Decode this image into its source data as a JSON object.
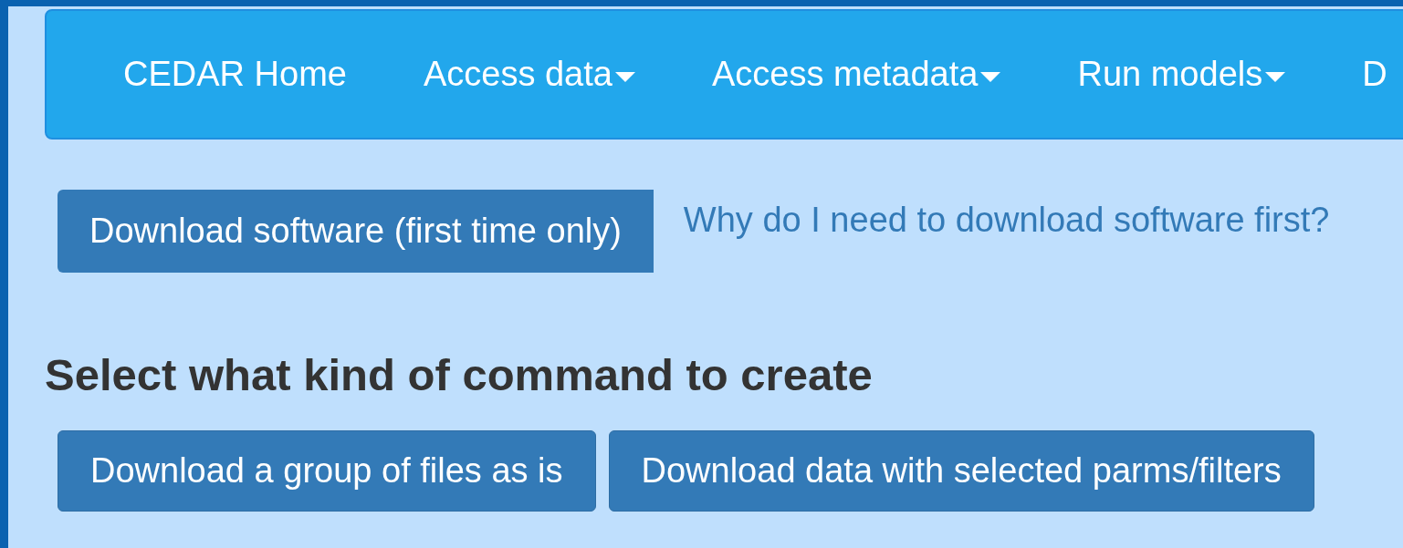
{
  "navbar": {
    "items": [
      {
        "label": "CEDAR Home",
        "dropdown": false
      },
      {
        "label": "Access data",
        "dropdown": true
      },
      {
        "label": "Access metadata",
        "dropdown": true
      },
      {
        "label": "Run models",
        "dropdown": true
      },
      {
        "label": "D",
        "dropdown": false
      }
    ]
  },
  "download_button": "Download software (first time only)",
  "help_link": "Why do I need to download software first?",
  "heading": "Select what kind of command to create",
  "command_buttons": [
    "Download a group of files as is",
    "Download data with selected parms/filters"
  ]
}
